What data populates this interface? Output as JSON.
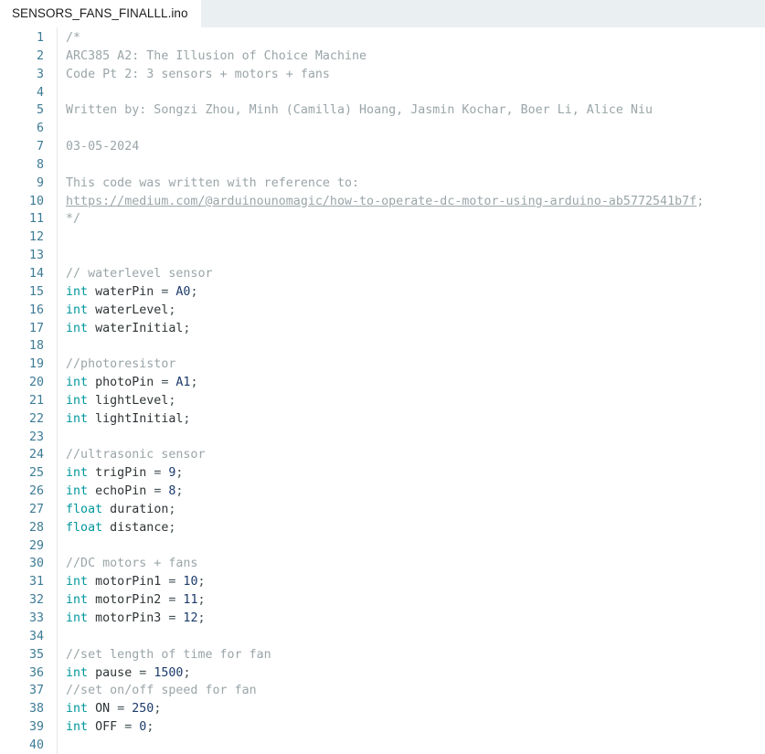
{
  "window": {
    "title": "SENSORS_FANS_FINALLL.ino"
  },
  "tabs": [
    {
      "label": "SENSORS_FANS_FINALLL.ino",
      "active": true
    }
  ],
  "colors": {
    "tabbar_background": "#eaf0f1",
    "tab_active_background": "#ffffff",
    "editor_background": "#ffffff",
    "line_number": "#3d7b95",
    "comment": "#9aa5a8",
    "keyword": "#00979c",
    "number": "#1b3a6b",
    "identifier": "#2e3436",
    "punctuation": "#434f54",
    "gutter_rule": "#e3e6e8"
  },
  "editor": {
    "first_line_number": 1,
    "last_line_number": 40,
    "total_lines": 40,
    "lines": [
      {
        "n": 1,
        "tokens": [
          {
            "t": "/*",
            "c": "tok-comment"
          }
        ]
      },
      {
        "n": 2,
        "tokens": [
          {
            "t": "ARC385 A2: The Illusion of Choice Machine",
            "c": "tok-comment"
          }
        ]
      },
      {
        "n": 3,
        "tokens": [
          {
            "t": "Code Pt 2: 3 sensors + motors + fans",
            "c": "tok-comment"
          }
        ]
      },
      {
        "n": 4,
        "tokens": []
      },
      {
        "n": 5,
        "tokens": [
          {
            "t": "Written by: Songzi Zhou, Minh (Camilla) Hoang, Jasmin Kochar, Boer Li, Alice Niu",
            "c": "tok-comment"
          }
        ]
      },
      {
        "n": 6,
        "tokens": []
      },
      {
        "n": 7,
        "tokens": [
          {
            "t": "03-05-2024",
            "c": "tok-comment"
          }
        ]
      },
      {
        "n": 8,
        "tokens": []
      },
      {
        "n": 9,
        "tokens": [
          {
            "t": "This code was written with reference to:",
            "c": "tok-comment"
          }
        ]
      },
      {
        "n": 10,
        "tokens": [
          {
            "t": "https://medium.com/@arduinounomagic/how-to-operate-dc-motor-using-arduino-ab5772541b7f",
            "c": "tok-link"
          },
          {
            "t": ";",
            "c": "tok-comment"
          }
        ]
      },
      {
        "n": 11,
        "tokens": [
          {
            "t": "*/",
            "c": "tok-comment"
          }
        ]
      },
      {
        "n": 12,
        "tokens": []
      },
      {
        "n": 13,
        "tokens": []
      },
      {
        "n": 14,
        "tokens": [
          {
            "t": "// waterlevel sensor",
            "c": "tok-comment"
          }
        ]
      },
      {
        "n": 15,
        "tokens": [
          {
            "t": "int",
            "c": "tok-kw"
          },
          {
            "t": " waterPin ",
            "c": "tok-id"
          },
          {
            "t": "= ",
            "c": "tok-op"
          },
          {
            "t": "A0",
            "c": "tok-const"
          },
          {
            "t": ";",
            "c": "tok-punct"
          }
        ]
      },
      {
        "n": 16,
        "tokens": [
          {
            "t": "int",
            "c": "tok-kw"
          },
          {
            "t": " waterLevel",
            "c": "tok-id"
          },
          {
            "t": ";",
            "c": "tok-punct"
          }
        ]
      },
      {
        "n": 17,
        "tokens": [
          {
            "t": "int",
            "c": "tok-kw"
          },
          {
            "t": " waterInitial",
            "c": "tok-id"
          },
          {
            "t": ";",
            "c": "tok-punct"
          }
        ]
      },
      {
        "n": 18,
        "tokens": []
      },
      {
        "n": 19,
        "tokens": [
          {
            "t": "//photoresistor",
            "c": "tok-comment"
          }
        ]
      },
      {
        "n": 20,
        "tokens": [
          {
            "t": "int",
            "c": "tok-kw"
          },
          {
            "t": " photoPin ",
            "c": "tok-id"
          },
          {
            "t": "= ",
            "c": "tok-op"
          },
          {
            "t": "A1",
            "c": "tok-const"
          },
          {
            "t": ";",
            "c": "tok-punct"
          }
        ]
      },
      {
        "n": 21,
        "tokens": [
          {
            "t": "int",
            "c": "tok-kw"
          },
          {
            "t": " lightLevel",
            "c": "tok-id"
          },
          {
            "t": ";",
            "c": "tok-punct"
          }
        ]
      },
      {
        "n": 22,
        "tokens": [
          {
            "t": "int",
            "c": "tok-kw"
          },
          {
            "t": " lightInitial",
            "c": "tok-id"
          },
          {
            "t": ";",
            "c": "tok-punct"
          }
        ]
      },
      {
        "n": 23,
        "tokens": []
      },
      {
        "n": 24,
        "tokens": [
          {
            "t": "//ultrasonic sensor",
            "c": "tok-comment"
          }
        ]
      },
      {
        "n": 25,
        "tokens": [
          {
            "t": "int",
            "c": "tok-kw"
          },
          {
            "t": " trigPin ",
            "c": "tok-id"
          },
          {
            "t": "= ",
            "c": "tok-op"
          },
          {
            "t": "9",
            "c": "tok-num"
          },
          {
            "t": ";",
            "c": "tok-punct"
          }
        ]
      },
      {
        "n": 26,
        "tokens": [
          {
            "t": "int",
            "c": "tok-kw"
          },
          {
            "t": " echoPin ",
            "c": "tok-id"
          },
          {
            "t": "= ",
            "c": "tok-op"
          },
          {
            "t": "8",
            "c": "tok-num"
          },
          {
            "t": ";",
            "c": "tok-punct"
          }
        ]
      },
      {
        "n": 27,
        "tokens": [
          {
            "t": "float",
            "c": "tok-kw"
          },
          {
            "t": " duration",
            "c": "tok-id"
          },
          {
            "t": ";",
            "c": "tok-punct"
          }
        ]
      },
      {
        "n": 28,
        "tokens": [
          {
            "t": "float",
            "c": "tok-kw"
          },
          {
            "t": " distance",
            "c": "tok-id"
          },
          {
            "t": ";",
            "c": "tok-punct"
          }
        ]
      },
      {
        "n": 29,
        "tokens": []
      },
      {
        "n": 30,
        "tokens": [
          {
            "t": "//DC motors + fans",
            "c": "tok-comment"
          }
        ]
      },
      {
        "n": 31,
        "tokens": [
          {
            "t": "int",
            "c": "tok-kw"
          },
          {
            "t": " motorPin1 ",
            "c": "tok-id"
          },
          {
            "t": "= ",
            "c": "tok-op"
          },
          {
            "t": "10",
            "c": "tok-num"
          },
          {
            "t": ";",
            "c": "tok-punct"
          }
        ]
      },
      {
        "n": 32,
        "tokens": [
          {
            "t": "int",
            "c": "tok-kw"
          },
          {
            "t": " motorPin2 ",
            "c": "tok-id"
          },
          {
            "t": "= ",
            "c": "tok-op"
          },
          {
            "t": "11",
            "c": "tok-num"
          },
          {
            "t": ";",
            "c": "tok-punct"
          }
        ]
      },
      {
        "n": 33,
        "tokens": [
          {
            "t": "int",
            "c": "tok-kw"
          },
          {
            "t": " motorPin3 ",
            "c": "tok-id"
          },
          {
            "t": "= ",
            "c": "tok-op"
          },
          {
            "t": "12",
            "c": "tok-num"
          },
          {
            "t": ";",
            "c": "tok-punct"
          }
        ]
      },
      {
        "n": 34,
        "tokens": []
      },
      {
        "n": 35,
        "tokens": [
          {
            "t": "//set length of time for fan",
            "c": "tok-comment"
          }
        ]
      },
      {
        "n": 36,
        "tokens": [
          {
            "t": "int",
            "c": "tok-kw"
          },
          {
            "t": " pause ",
            "c": "tok-id"
          },
          {
            "t": "= ",
            "c": "tok-op"
          },
          {
            "t": "1500",
            "c": "tok-num"
          },
          {
            "t": ";",
            "c": "tok-punct"
          }
        ]
      },
      {
        "n": 37,
        "tokens": [
          {
            "t": "//set on/off speed for fan",
            "c": "tok-comment"
          }
        ]
      },
      {
        "n": 38,
        "tokens": [
          {
            "t": "int",
            "c": "tok-kw"
          },
          {
            "t": " ON ",
            "c": "tok-id"
          },
          {
            "t": "= ",
            "c": "tok-op"
          },
          {
            "t": "250",
            "c": "tok-num"
          },
          {
            "t": ";",
            "c": "tok-punct"
          }
        ]
      },
      {
        "n": 39,
        "tokens": [
          {
            "t": "int",
            "c": "tok-kw"
          },
          {
            "t": " OFF ",
            "c": "tok-id"
          },
          {
            "t": "= ",
            "c": "tok-op"
          },
          {
            "t": "0",
            "c": "tok-num"
          },
          {
            "t": ";",
            "c": "tok-punct"
          }
        ]
      },
      {
        "n": 40,
        "tokens": []
      }
    ]
  }
}
